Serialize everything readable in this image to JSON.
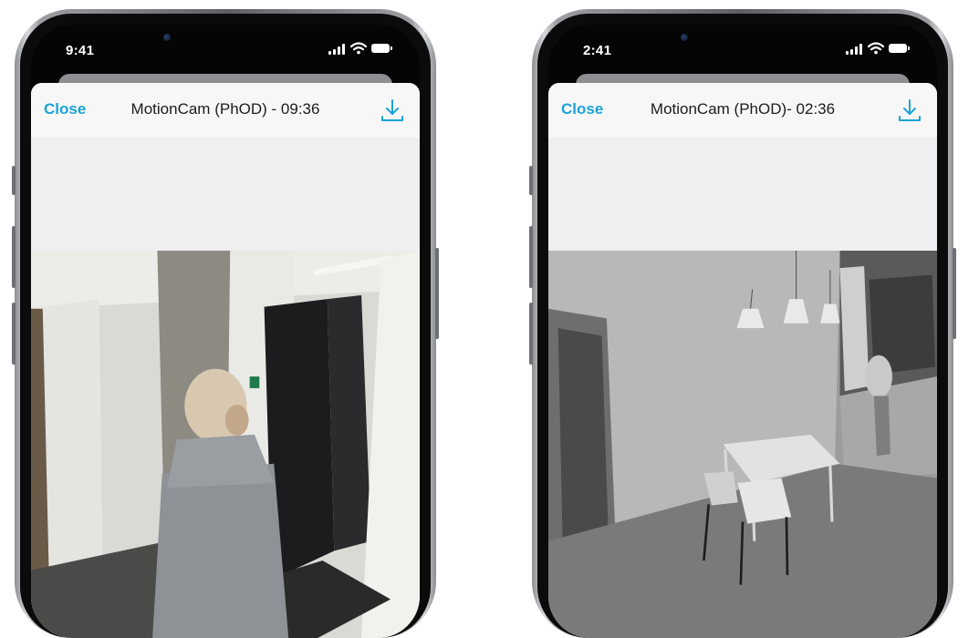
{
  "colors": {
    "accent": "#1aa3d6",
    "sheet": "#efeff1",
    "navbar": "#f7f7f8"
  },
  "phones": [
    {
      "status_time": "9:41",
      "close_label": "Close",
      "title": "MotionCam (PhOD) - 09:36",
      "download_icon": "download-icon",
      "photo": {
        "mode": "color",
        "scene": "hallway"
      }
    },
    {
      "status_time": "2:41",
      "close_label": "Close",
      "title": "MotionCam (PhOD)- 02:36",
      "download_icon": "download-icon",
      "photo": {
        "mode": "night-ir",
        "scene": "kitchen"
      }
    }
  ]
}
